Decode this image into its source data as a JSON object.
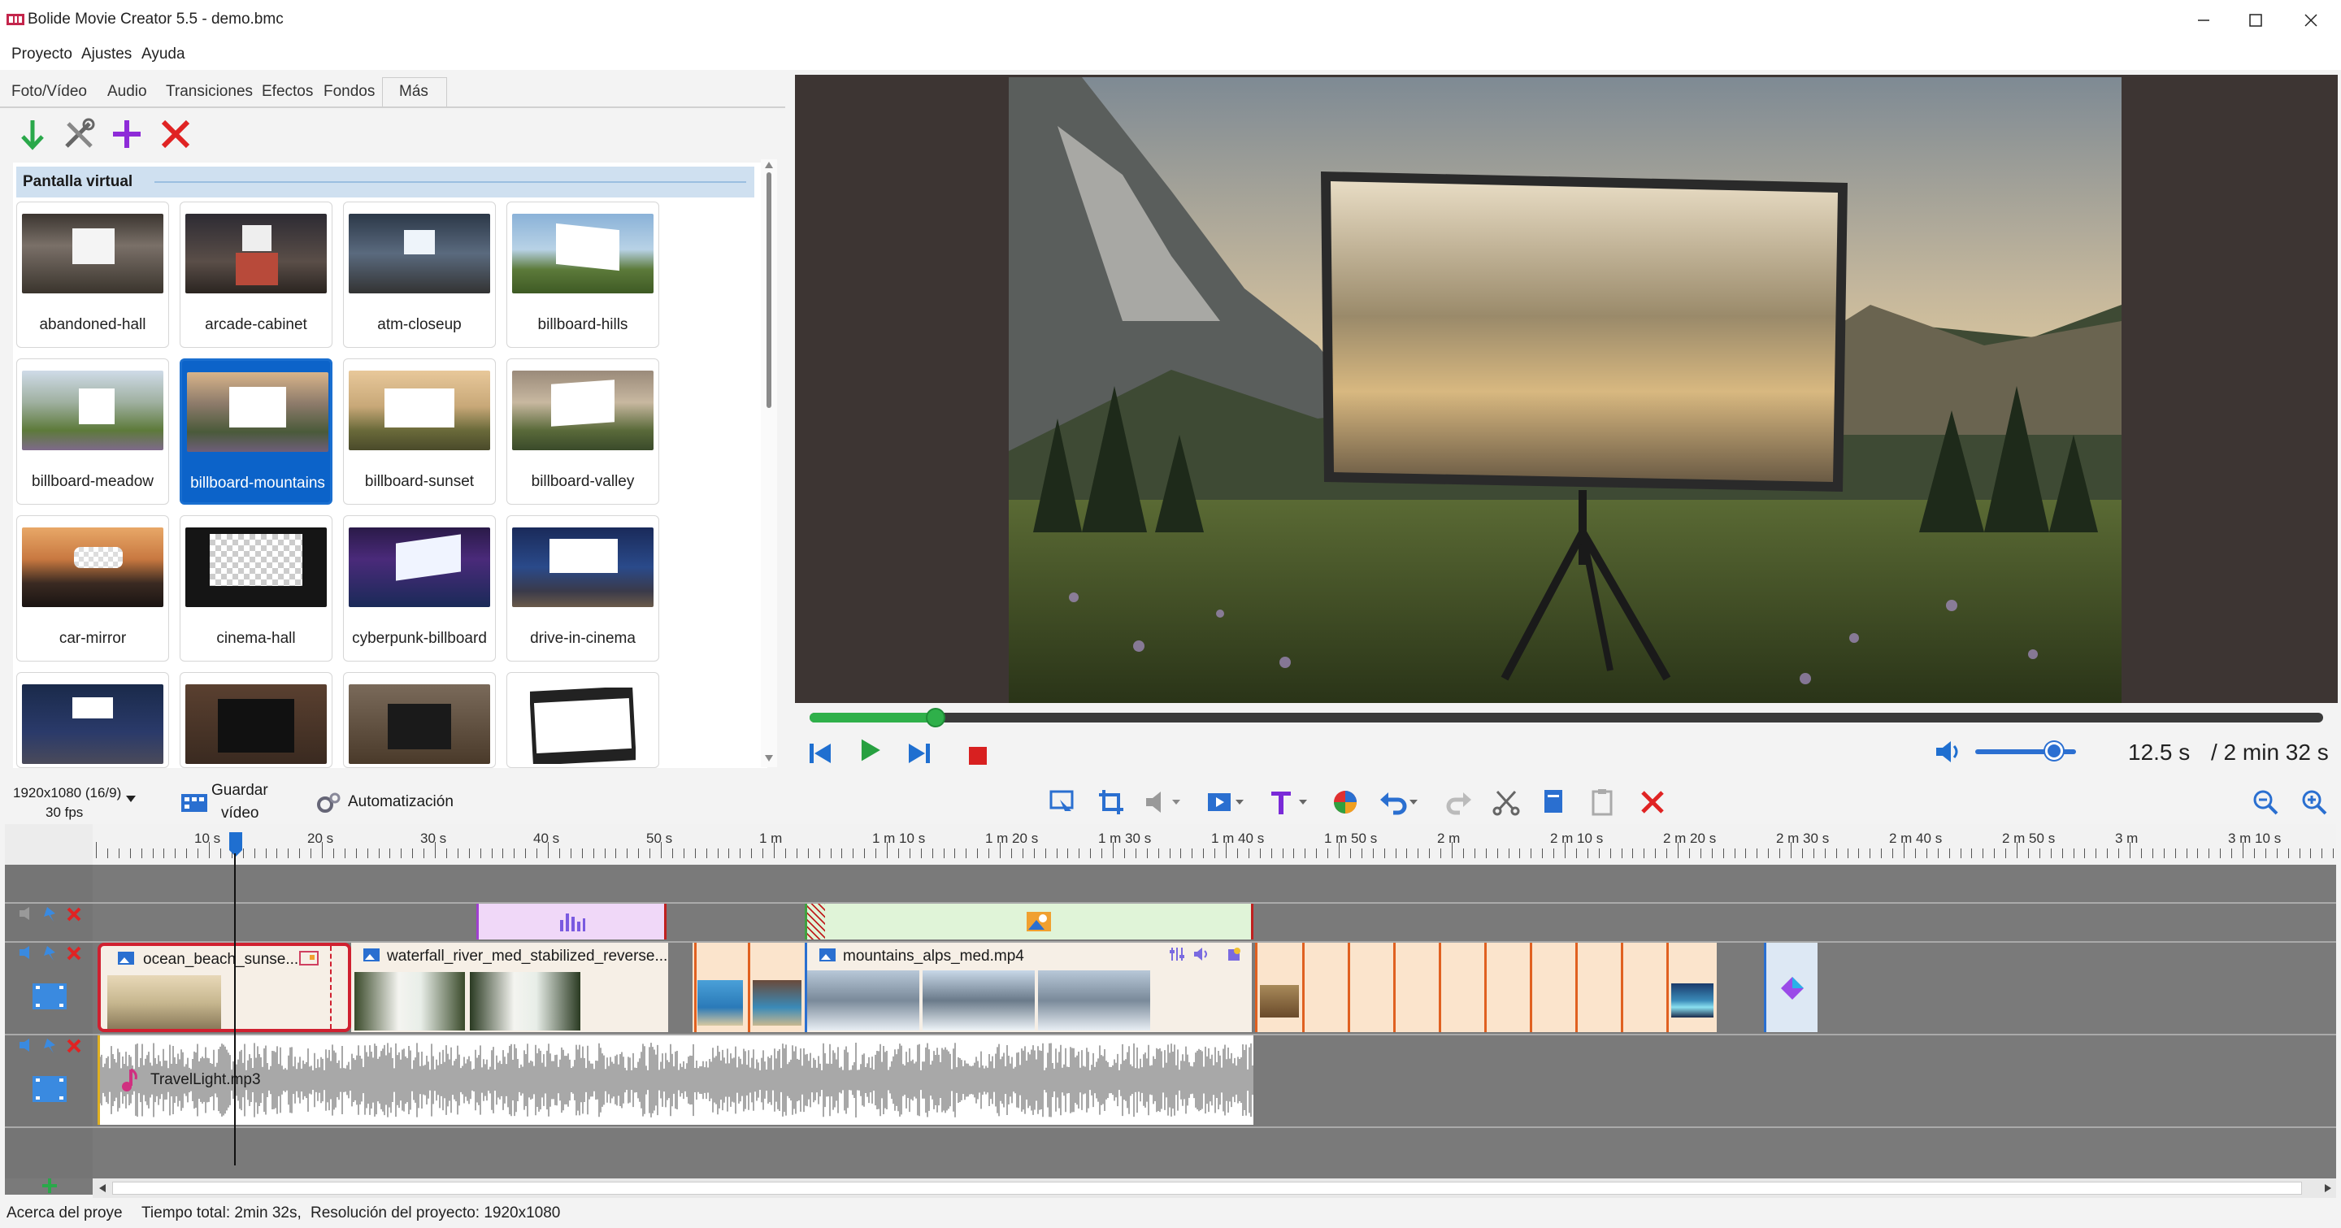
{
  "window": {
    "title": "Bolide Movie Creator 5.5 - demo.bmc"
  },
  "menubar": {
    "items": [
      "Proyecto",
      "Ajustes",
      "Ayuda"
    ]
  },
  "tabs": [
    "Foto/Vídeo",
    "Audio",
    "Transiciones",
    "Efectos",
    "Fondos",
    "Más"
  ],
  "library": {
    "group_title": "Pantalla virtual",
    "items": [
      "abandoned-hall",
      "arcade-cabinet",
      "atm-closeup",
      "billboard-hills",
      "billboard-meadow",
      "billboard-mountains",
      "billboard-sunset",
      "billboard-valley",
      "car-mirror",
      "cinema-hall",
      "cyberpunk-billboard",
      "drive-in-cinema"
    ],
    "selected": "billboard-mountains"
  },
  "playback": {
    "current_time": "12.5 s",
    "total_time": "/ 2 min 32 s",
    "progress": 0.083,
    "volume": 0.78
  },
  "project": {
    "resolution_label": "1920x1080 (16/9)",
    "fps_label": "30 fps",
    "save_label_1": "Guardar",
    "save_label_2": "vídeo",
    "automation_label": "Automatización"
  },
  "ruler": {
    "labels": [
      "10 s",
      "20 s",
      "30 s",
      "40 s",
      "50 s",
      "1 m",
      "1 m 10 s",
      "1 m 20 s",
      "1 m 30 s",
      "1 m 40 s",
      "1 m 50 s",
      "2 m",
      "2 m 10 s",
      "2 m 20 s",
      "2 m 30 s",
      "2 m 40 s",
      "2 m 50 s",
      "3 m",
      "3 m 10 s"
    ]
  },
  "clips": {
    "clip1": "ocean_beach_sunse...",
    "clip2": "waterfall_river_med_stabilized_reverse...",
    "clip3": "mountains_alps_med.mp4",
    "audio": "TravelLight.mp3"
  },
  "status": {
    "about": "Acerca del proye",
    "total_time": "Tiempo total: 2min 32s,",
    "resolution": "Resolución del proyecto:   1920x1080"
  },
  "colors": {
    "accent": "#1a6fd0",
    "play_green": "#2fb04a",
    "delete_red": "#e02323",
    "add_purple": "#8e2bd8"
  }
}
